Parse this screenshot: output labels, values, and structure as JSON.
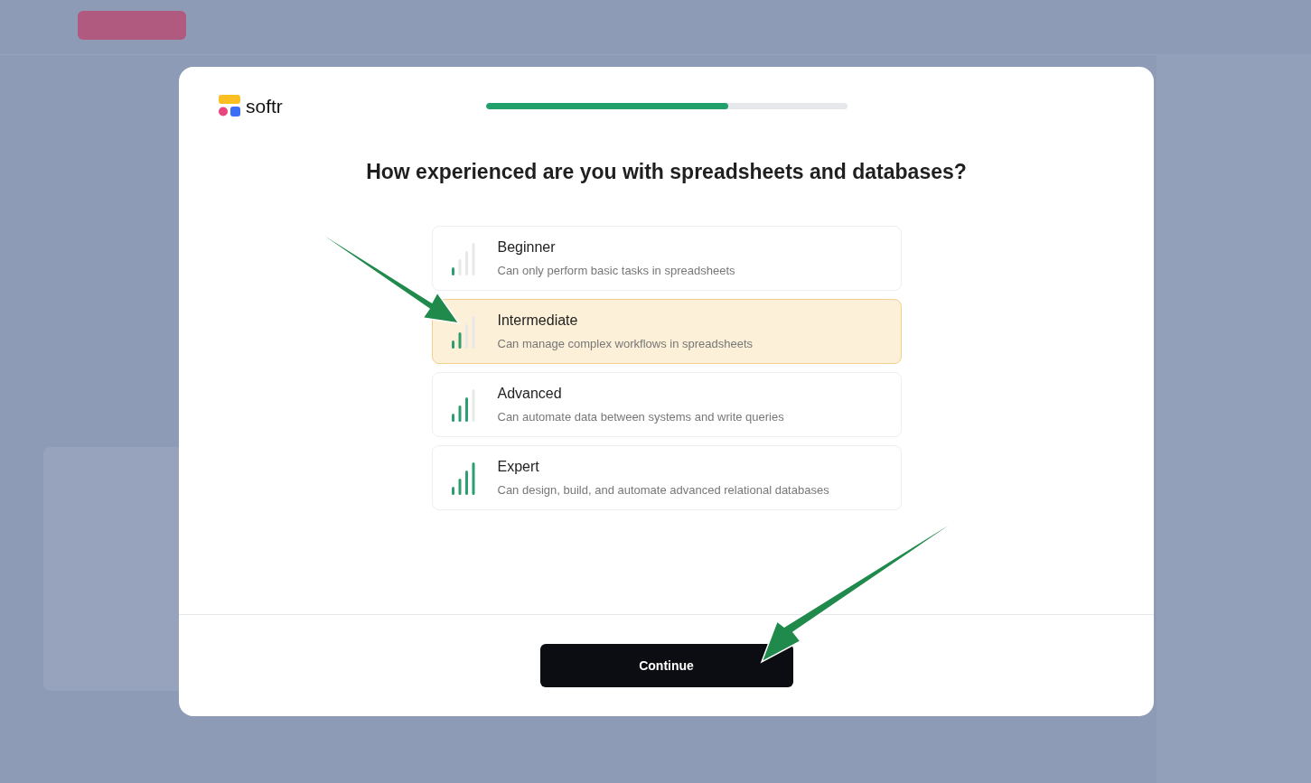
{
  "modal": {
    "logo": "softr",
    "progress": {
      "level": 0.67
    },
    "question": "How experienced are you with spreadsheets and databases?",
    "options": [
      {
        "title": "Beginner",
        "description": "Can only perform basic tasks in spreadsheets",
        "kind": "low",
        "selected": false
      },
      {
        "title": "Intermediate",
        "description": "Can manage complex workflows in spreadsheets",
        "kind": "medium",
        "selected": true
      },
      {
        "title": "Advanced",
        "description": "Can automate data between systems and write queries",
        "kind": "high",
        "selected": false
      },
      {
        "title": "Expert",
        "description": "Can design, build, and automate advanced relational databases",
        "kind": "full",
        "selected": false
      }
    ],
    "button": "Continue"
  }
}
